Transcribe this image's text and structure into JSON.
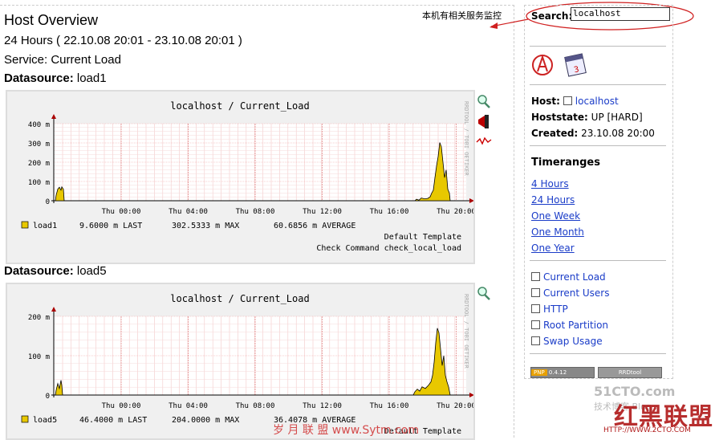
{
  "page": {
    "title": "Host Overview",
    "period": "24 Hours ( 22.10.08 20:01 - 23.10.08 20:01 )",
    "service": "Service: Current Load",
    "annotation": "本机有相关服务监控"
  },
  "datasources": [
    {
      "label_bold": "Datasource:",
      "label_value": "load1",
      "graph": {
        "title": "localhost / Current_Load",
        "side_text": "RRDTOOL / TOBI OETIKER",
        "yticks": [
          "400 m",
          "300 m",
          "200 m",
          "100 m",
          "0"
        ],
        "xticks": [
          "Thu 00:00",
          "Thu 04:00",
          "Thu 08:00",
          "Thu 12:00",
          "Thu 16:00",
          "Thu 20:00"
        ],
        "legend": {
          "name": "load1",
          "last": "9.6000 m LAST",
          "max": "302.5333 m MAX",
          "avg": "60.6856 m AVERAGE"
        },
        "footer1": "Default Template",
        "footer2": "Check Command check_local_load"
      }
    },
    {
      "label_bold": "Datasource:",
      "label_value": "load5",
      "graph": {
        "title": "localhost / Current_Load",
        "side_text": "RRDTOOL / TOBI OETIKER",
        "yticks": [
          "200 m",
          "100 m",
          "0"
        ],
        "xticks": [
          "Thu 00:00",
          "Thu 04:00",
          "Thu 08:00",
          "Thu 12:00",
          "Thu 16:00",
          "Thu 20:00"
        ],
        "legend": {
          "name": "load5",
          "last": "46.4000 m LAST",
          "max": "204.0000 m MAX",
          "avg": "36.4078 m AVERAGE"
        },
        "footer1": "Default Template"
      }
    }
  ],
  "sidebar": {
    "search_label": "Search:",
    "search_value": "localhost",
    "host_label": "Host:",
    "host_value": "localhost",
    "hoststate_label": "Hoststate:",
    "hoststate_value": "UP [HARD]",
    "created_label": "Created:",
    "created_value": "23.10.08 20:00",
    "timeranges_title": "Timeranges",
    "timeranges": [
      "4 Hours",
      "24 Hours",
      "One Week",
      "One Month",
      "One Year"
    ],
    "services": [
      "Current Load",
      "Current Users",
      "HTTP",
      "Root Partition",
      "Swap Usage"
    ],
    "badge_pnp": "PNP",
    "badge_version": "0.4.12",
    "badge_rrd": "RRDtool"
  },
  "watermarks": {
    "site": "51CTO.com",
    "blog": "技术博客 Blog",
    "brand": "红黑联盟",
    "url": "HTTP://WWW.2CTO.COM",
    "center": "岁 月 联 盟 www.Sytm.com"
  }
}
